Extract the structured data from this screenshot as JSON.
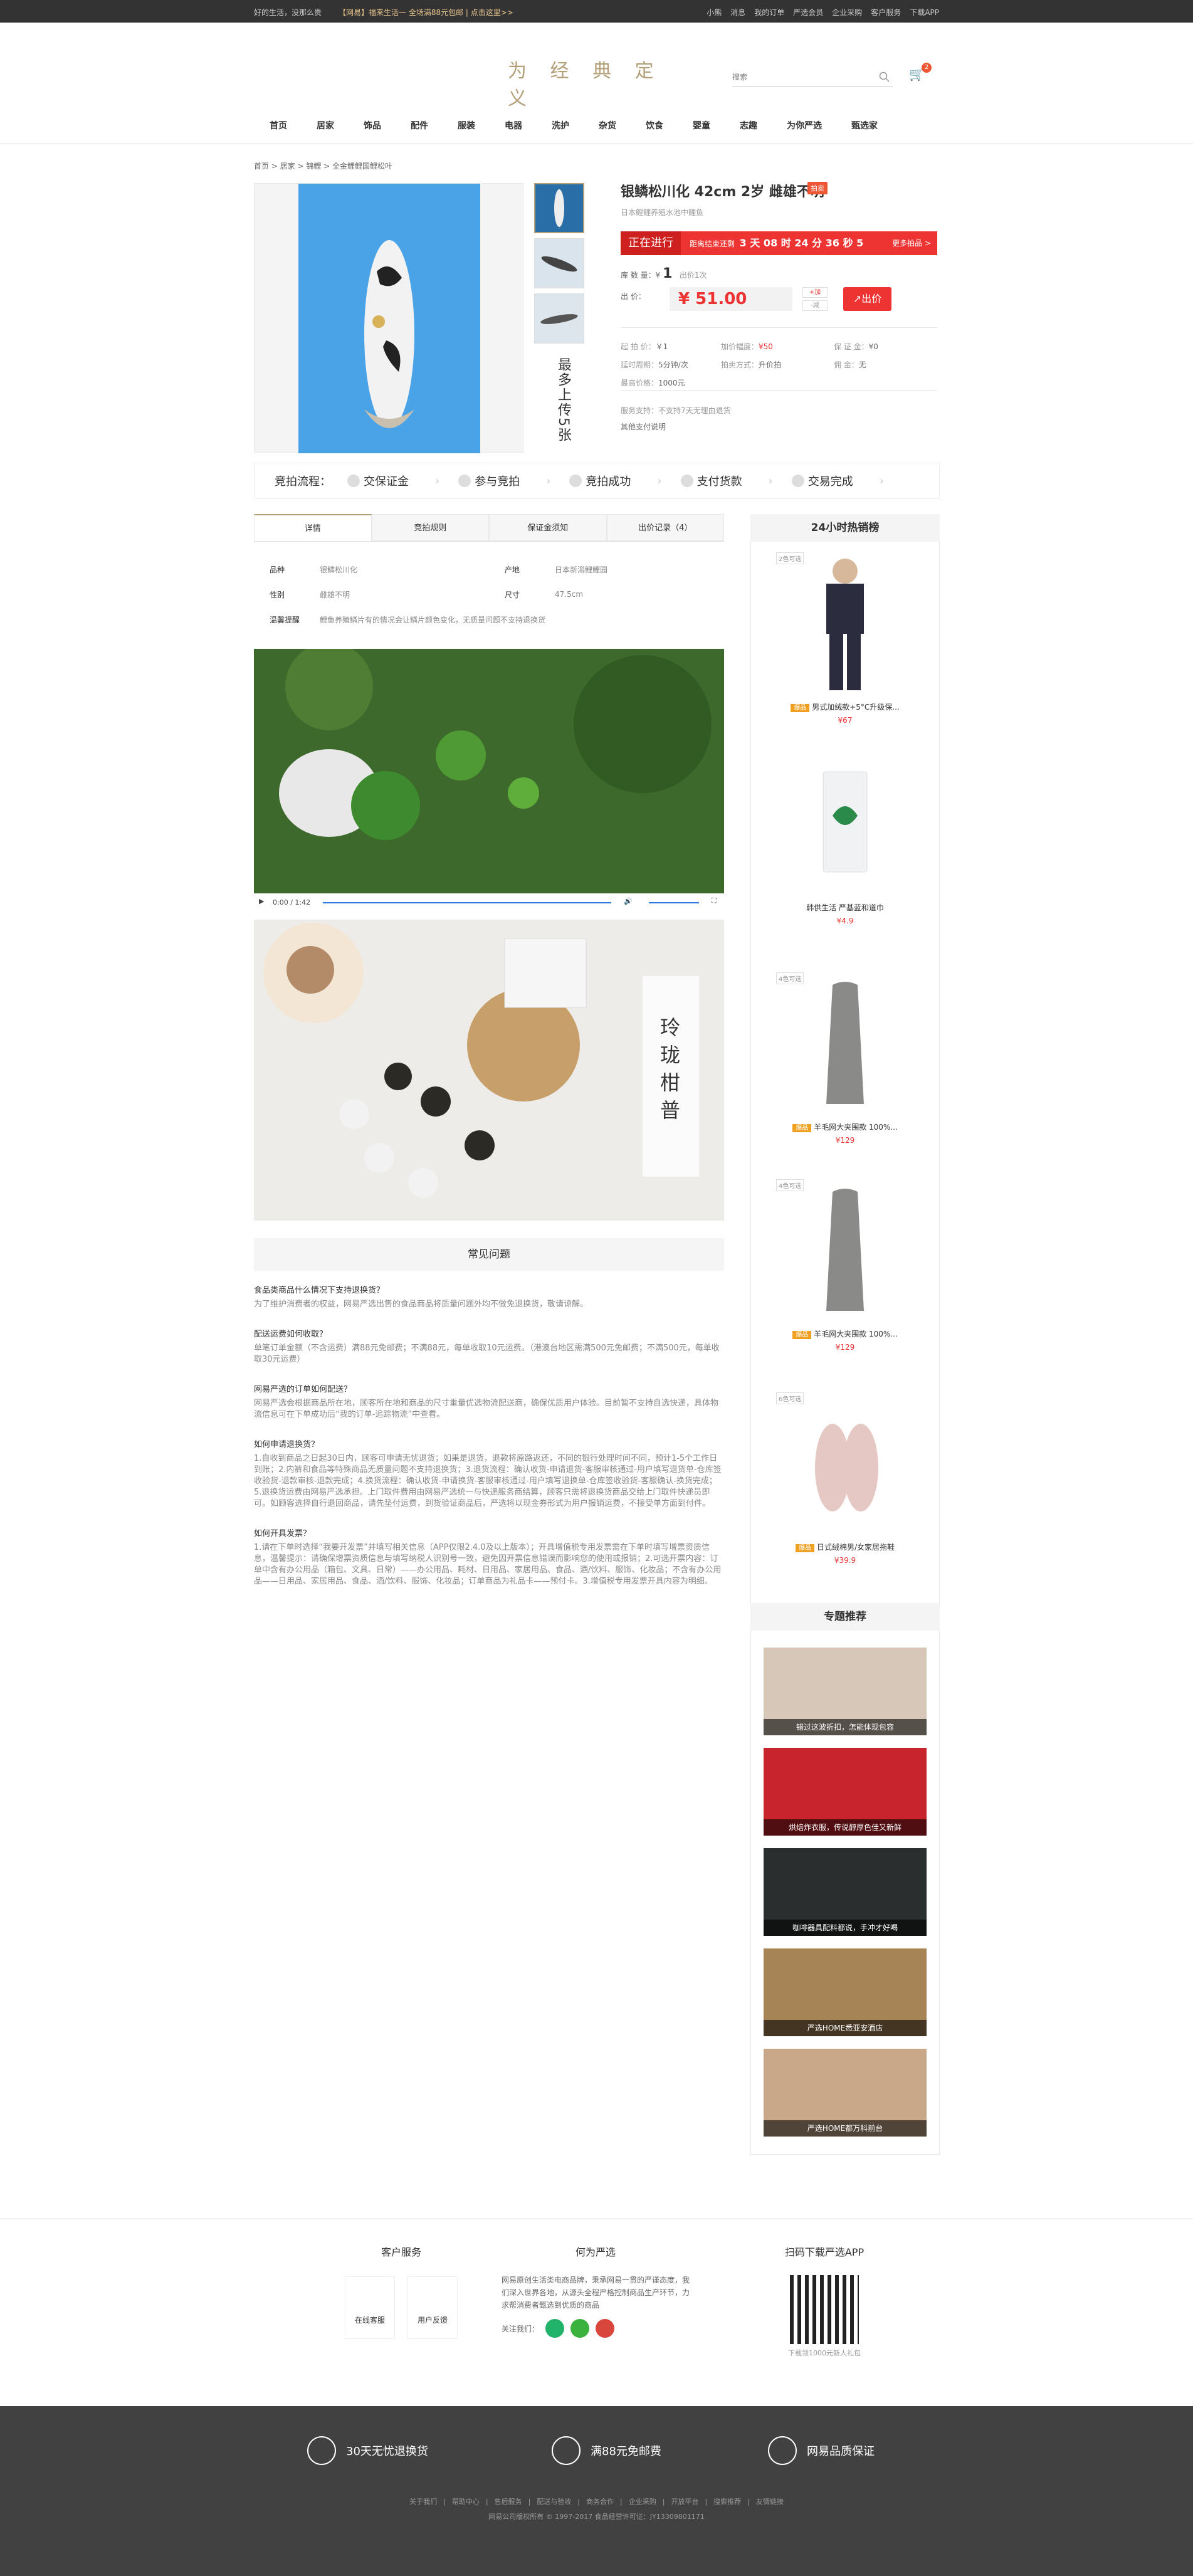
{
  "topbar": {
    "left": "好的生活，没那么贵",
    "notice": "【网易】福来生活一 全场满88元包邮 | 点击这里>>",
    "right": [
      "小熊",
      "消息",
      "我的订单",
      "严选会员",
      "企业采购",
      "客户服务",
      "下载APP"
    ]
  },
  "header": {
    "logo": "为 经 典 定 义",
    "search_placeholder": "搜索",
    "cart_count": "2"
  },
  "nav": [
    "首页",
    "居家",
    "饰品",
    "配件",
    "服装",
    "电器",
    "洗护",
    "杂货",
    "饮食",
    "婴童",
    "志趣",
    "为你严选",
    "甄选家"
  ],
  "breadcrumb": "首页 > 居家 > 锦鲤 > 全金鲤鲤国鲤松叶",
  "product": {
    "title": "银鳞松川化 42cm 2岁 雌雄不明",
    "tag": "拍卖",
    "subtitle": "日本鲤鲤养殖水池中鲤鱼",
    "status": "正在进行",
    "countdown_label": "距离结束还剩",
    "countdown": "3 天 08 时 24 分 36 秒 5",
    "more": "更多拍品 >",
    "stock_label": "库 数 量：",
    "stock": "1",
    "stock_unit": "出价1次",
    "price_label": "出    价：",
    "price": "51.00",
    "plus": "+加",
    "minus": "-减",
    "bid": "出价",
    "attrs": [
      [
        "起 拍 价：",
        "￥1"
      ],
      [
        "加价幅度：",
        "¥50"
      ],
      [
        "保 证 金：",
        "¥0"
      ],
      [
        "延时周期：",
        "5分钟/次"
      ],
      [
        "拍卖方式：",
        "升价拍"
      ],
      [
        "佣    金：",
        "无"
      ],
      [
        "最高价格：",
        "1000元"
      ]
    ],
    "service": "服务支持：不支持7天无理由退货",
    "other": "其他支付说明"
  },
  "flow": {
    "title": "竞拍流程：",
    "steps": [
      "交保证金",
      "参与竞拍",
      "竞拍成功",
      "支付货款",
      "交易完成"
    ]
  },
  "tabs": [
    "详情",
    "竞拍规则",
    "保证金须知",
    "出价记录（4）"
  ],
  "spec": [
    [
      "品种",
      "银鳞松川化",
      "产地",
      "日本新潟鲤鲤园"
    ],
    [
      "性别",
      "雌雄不明",
      "尺寸",
      "47.5cm"
    ],
    [
      "温馨提醒",
      "鲤鱼养殖鳞片有的情况会让鳞片颜色变化，无质量问题不支持退换货"
    ]
  ],
  "video": {
    "time": "0:00 / 1:42"
  },
  "banner_text": [
    "玲",
    "珑",
    "柑",
    "普"
  ],
  "faq": {
    "title": "常见问题",
    "items": [
      {
        "q": "食品类商品什么情况下支持退换货？",
        "a": "为了维护消费者的权益，网易严选出售的食品商品将质量问题外均不做免退换货，敬请谅解。"
      },
      {
        "q": "配送运费如何收取？",
        "a": "单笔订单金额（不含运费）满88元免邮费；不满88元，每单收取10元运费。（港澳台地区需满500元免邮费；不满500元，每单收取30元运费）"
      },
      {
        "q": "网易严选的订单如何配送？",
        "a": "网易严选会根据商品所在地，顾客所在地和商品的尺寸重量优选物流配送商，确保优质用户体验。目前暂不支持自选快递，具体物流信息可在下单成功后“我的订单-追踪物流”中查看。"
      },
      {
        "q": "如何申请退换货？",
        "a": "1.自收到商品之日起30日内，顾客可申请无忧退货；如果是退货，退款将原路返还，不同的银行处理时间不同，预计1-5个工作日到账；2.内裤和食品等特殊商品无质量问题不支持退换货；3.退货流程：确认收货-申请退货-客服审核通过-用户填写退货单-仓库签收验货-退款审核-退款完成；4.换货流程：确认收货-申请换货-客服审核通过-用户填写退换单-仓库签收验货-客服确认-换货完成；5.退换货运费由网易严选承担。上门取件费用由网易严选统一与快递服务商结算，顾客只需将退换货商品交给上门取件快递员即可。如顾客选择自行退回商品，请先垫付运费，到货验证商品后，严选将以现金券形式为用户报销运费，不接受单方面到付件。"
      },
      {
        "q": "如何开具发票？",
        "a": "1.请在下单时选择“我要开发票”并填写相关信息（APP仅限2.4.0及以上版本）；开具增值税专用发票需在下单时填写增票资质信息，温馨提示：请确保增票资质信息与填写纳税人识别号一致，避免因开票信息错误而影响您的使用或报销；2.可选开票内容：订单中含有办公用品（箱包、文具、日常）——办公用品、耗材、日用品、家居用品、食品、酒/饮料、服饰、化妆品；不含有办公用品——日用品、家居用品、食品、酒/饮料、服饰、化妆品；订单商品为礼品卡——预付卡。3.增值税专用发票开具内容为明细。"
      }
    ]
  },
  "sidebar": {
    "title": "24小时热销榜",
    "items": [
      {
        "tag": "2色可选",
        "hot": "爆品",
        "name": "男式加绒款+5°C升级保...",
        "price": "¥67"
      },
      {
        "tag": "",
        "hot": "",
        "name": "韩供生活 严基蓝和道巾",
        "price": "¥4.9"
      },
      {
        "tag": "4色可选",
        "hot": "爆品",
        "name": "羊毛网大夹围款 100%...",
        "price": "¥129"
      },
      {
        "tag": "4色可选",
        "hot": "爆品",
        "name": "羊毛网大夹围款 100%...",
        "price": "¥129"
      },
      {
        "tag": "6色可选",
        "hot": "爆品",
        "name": "日式绒棉男/女家居拖鞋",
        "price": "¥39.9"
      }
    ]
  },
  "topics": {
    "title": "专题推荐",
    "items": [
      "错过这波折扣，怎能体现包容",
      "烘焙炸衣服，传说醇厚色佳又新鲜",
      "咖啡器具配料都说，手冲才好喝",
      "严选HOME悉亚安酒店",
      "严选HOME都万科前台"
    ]
  },
  "footer": {
    "service_title": "客户服务",
    "service_btns": [
      "在线客服",
      "用户反馈"
    ],
    "about_title": "何为严选",
    "about_text": "网易原创生活类电商品牌，秉承网易一贯的严谨态度，我们深入世界各地，从源头全程严格控制商品生产环节，力求帮消费者甄选到优质的商品",
    "follow": "关注我们：",
    "app_title": "扫码下载严选APP",
    "app_sub": "下载领1000元新人礼包",
    "features": [
      "30天无忧退换货",
      "满88元免邮费",
      "网易品质保证"
    ],
    "links": [
      "关于我们",
      "帮助中心",
      "售后服务",
      "配送与验收",
      "商务合作",
      "企业采购",
      "开放平台",
      "搜索推荐",
      "友情链接"
    ],
    "copyright": "网易公司版权所有 © 1997-2017  食品经营许可证：JY13309801171"
  }
}
